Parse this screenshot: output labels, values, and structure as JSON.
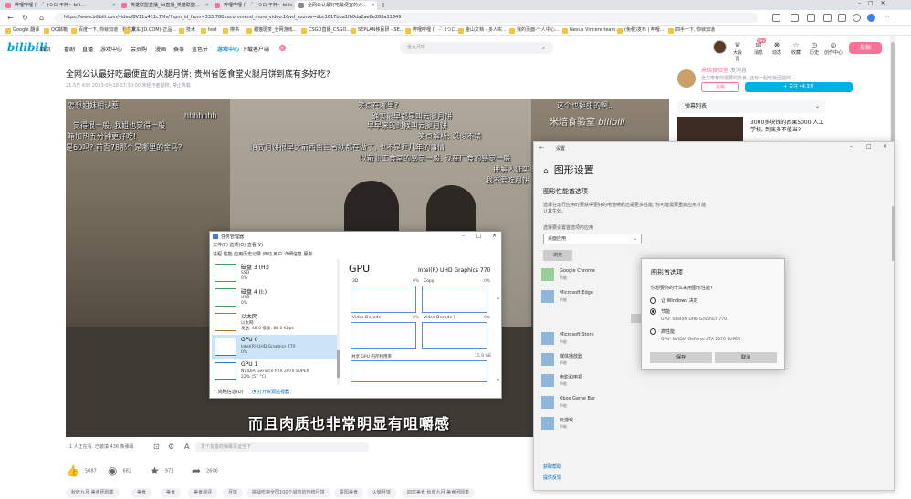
{
  "browser": {
    "tabs": [
      {
        "label": "哔哩哔哩 (゜-゜)つロ 干杯~-bili..."
      },
      {
        "label": "英雄联盟直播_lol直播_英雄联盟..."
      },
      {
        "label": "哔哩哔哩 (゜-゜)つロ 干杯~-bili..."
      },
      {
        "label": "全网公认最好吃最便宜的火..."
      }
    ],
    "url": "https://www.bilibili.com/video/BV11u411c7Mv/?spm_id_from=333.788.recommend_more_video.1&vd_source=dbc1617bba1fb0da2ae8e288a11349",
    "bookmarks": [
      "Google 翻译",
      "QQ邮箱",
      "百度一下, 你就知道 | 我的素...",
      "京东(JD.COM)-正品...",
      "技术",
      "test",
      "擦书",
      "甜猫斑茶_全网游戏...",
      "CSGO直播_CSGO...",
      "SEPLAN移民研 - SE...",
      "哔哩哔哩 (゜-゜)つロ...",
      "金山文档 - 多人实...",
      "我的页面-个人中心...",
      "Nexus Vincere team...",
      "(免税)发布 | 哔哩...",
      "四手一下, 你就知道"
    ]
  },
  "site": {
    "logo": "bilibili",
    "nav": [
      "首页",
      "番剧",
      "直播",
      "游戏中心",
      "会员购",
      "漫画",
      "赛事",
      "蓝色节",
      "游戏中心",
      "下载客户端"
    ],
    "nav_badge": "新",
    "search_placeholder": "金九月饼",
    "header_icons": [
      "大会员",
      "消息",
      "动态",
      "收藏",
      "历史",
      "创作中心"
    ],
    "msg_count": "99+",
    "upload": "投稿"
  },
  "video": {
    "title": "全网公认最好吃最便宜的火腿月饼: 贵州省医食堂火腿月饼到底有多好吃?",
    "meta": "21.5万   436   2023-09-18 17:30:00   未经作者授权, 禁止转载",
    "danmaku": [
      "怎想姐妹相认惹",
      "笑点在哪里?",
      "这个也挺甜的啊..",
      "确实最早都是叫云腿月饼",
      "觉得很一般, 我姐也觉得一般",
      "hhhhhhh",
      "早早来的时候叫云腿月饼",
      "箱加热五分钟更好吃!",
      "笑点解析: 忍俊不禁",
      "是60吗? 前面78那个是哪里的金马?",
      "滇式月饼很早之前西南三省就都在做了, 也不是近几年的事情",
      "以前职工食堂的感觉一般, 现在厂食的感觉一般",
      "押解人证实 这",
      "我不爱吃月饼"
    ],
    "watermark": "米焙食验室",
    "watermark2": "bilibili",
    "subtitle": "而且肉质也非常明显有咀嚼感",
    "watching": "1 人正在看, 已装填 436 条弹幕",
    "danmaku_placeholder": "发个友善的弹幕见证当下",
    "likes": "5087",
    "coins": "682",
    "favs": "971",
    "shares": "2606",
    "tags": [
      "秋收九月 美食团圆季",
      "美食",
      "美食",
      "美食测评",
      "月饼",
      "挑战吃遍全国100个城市的传统月饼",
      "贵阳美食",
      "火腿月饼",
      "四季美食 秋收九月 美食团圆季"
    ]
  },
  "up": {
    "name": "米焙食验室",
    "badge": "发消息",
    "desc": "全力推荐你需要的美食, 还有一起吃饭团圆的...",
    "charge": "充电",
    "follow": "+ 关注 44.3万"
  },
  "playlist": {
    "label": "弹幕列表"
  },
  "recommend": [
    {
      "title": "3000多块钱的西果5000 人工学校, 到底多不值当?"
    }
  ],
  "settings": {
    "window_title": "设置",
    "heading": "图形设置",
    "sub": "图形性能首选项",
    "desc": "选择在运行应用时要获得更好的电池续航还是更多性能, 你可能需要重启应用才能让其生效。",
    "choose_label": "选择要设置首选项的应用",
    "select_value": "桌面应用",
    "browse": "浏览",
    "apps": [
      {
        "name": "Google Chrome",
        "state": "节能"
      },
      {
        "name": "Microsoft Edge",
        "state": "节能"
      },
      {
        "name": "Microsoft Store",
        "state": "节能"
      },
      {
        "name": "媒体播放器",
        "state": "节能"
      },
      {
        "name": "电影和电视",
        "state": "节能"
      },
      {
        "name": "Xbox Game Bar",
        "state": "节能"
      },
      {
        "name": "玩游戏",
        "state": "节能"
      }
    ],
    "help": "获取帮助",
    "feedback": "提供反馈"
  },
  "gpdialog": {
    "title": "图形首选项",
    "question": "你想要你的什么来用图形性能?",
    "opt1": "让 Windows 决定",
    "opt2": "节能",
    "opt2_sub": "GPU: Intel(R) UHD Graphics 770",
    "opt3": "高性能",
    "opt3_sub": "GPU: NVIDIA GeForce RTX 2070 SUPER",
    "selected": "节能",
    "save": "保存",
    "cancel": "取消"
  },
  "taskmgr": {
    "title": "任务管理器",
    "menu": "文件(F)   选项(O)   查看(V)",
    "tabs": "进程   性能   应用历史记录   启动   用户   详细信息   服务",
    "items": [
      {
        "name": "磁盘 3 (H:)",
        "s1": "SSD",
        "s2": "0%"
      },
      {
        "name": "磁盘 4 (I:)",
        "s1": "USB",
        "s2": "0%"
      },
      {
        "name": "以太网",
        "s1": "以太网",
        "s2": "发送: 48.0 接收: 88.0 Kbps"
      },
      {
        "name": "GPU 0",
        "s1": "Intel(R) UHD Graphics 770",
        "s2": "0%"
      },
      {
        "name": "GPU 1",
        "s1": "NVIDIA GeForce RTX 2070 SUPER",
        "s2": "22% (57 °C)"
      }
    ],
    "gpu_heading": "GPU",
    "gpu_name": "Intel(R) UHD Graphics 770",
    "graphs": [
      {
        "label": "3D",
        "pct": "0%"
      },
      {
        "label": "Copy",
        "pct": "0%"
      },
      {
        "label": "Video Decode",
        "pct": "0%"
      },
      {
        "label": "Video Decode 1",
        "pct": "0%"
      }
    ],
    "shared_label": "共享 GPU 内存利用率",
    "shared_val": "15.9 GB",
    "fewer": "简略信息(D)",
    "resmon": "打开资源监视器"
  }
}
